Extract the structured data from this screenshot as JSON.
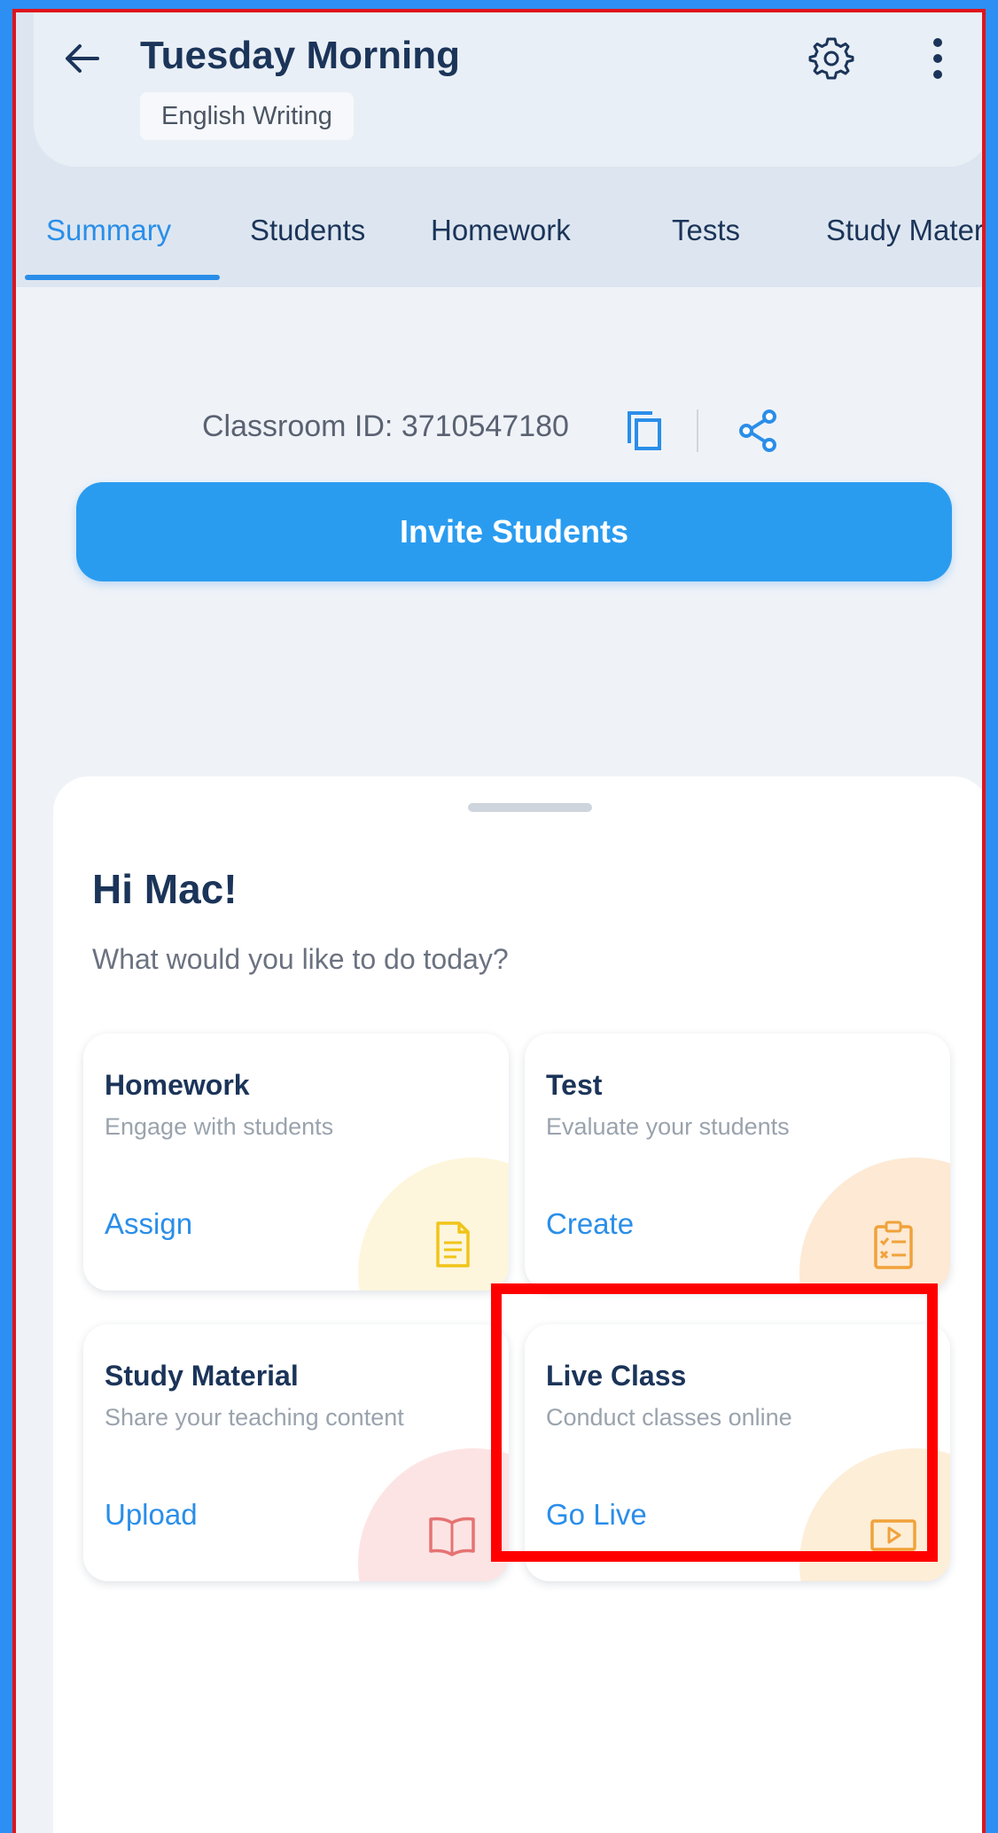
{
  "header": {
    "title": "Tuesday Morning",
    "subject": "English Writing"
  },
  "tabs": [
    {
      "label": "Summary",
      "active": true
    },
    {
      "label": "Students",
      "active": false
    },
    {
      "label": "Homework",
      "active": false
    },
    {
      "label": "Tests",
      "active": false
    },
    {
      "label": "Study Mater",
      "active": false
    }
  ],
  "classroom": {
    "id_text": "Classroom ID: 3710547180"
  },
  "invite": {
    "label": "Invite Students"
  },
  "sheet": {
    "greeting": "Hi Mac!",
    "prompt": "What would you like to do today?",
    "cards": [
      {
        "title": "Homework",
        "subtitle": "Engage with students",
        "action": "Assign",
        "icon": "document-icon",
        "blob_color": "#fdf6dc",
        "icon_color": "#f0c419"
      },
      {
        "title": "Test",
        "subtitle": "Evaluate your students",
        "action": "Create",
        "icon": "clipboard-checklist-icon",
        "blob_color": "#fde9d4",
        "icon_color": "#f0a23a"
      },
      {
        "title": "Study Material",
        "subtitle": "Share your teaching content",
        "action": "Upload",
        "icon": "open-book-icon",
        "blob_color": "#fde4e4",
        "icon_color": "#e57373"
      },
      {
        "title": "Live Class",
        "subtitle": "Conduct classes online",
        "action": "Go Live",
        "icon": "video-play-icon",
        "blob_color": "#fdeed8",
        "icon_color": "#f0a23a"
      }
    ]
  },
  "colors": {
    "accent": "#2a8ee9",
    "title_text": "#1b3459",
    "outer_border": "#2d8ff3",
    "highlight": "#ff0000"
  }
}
